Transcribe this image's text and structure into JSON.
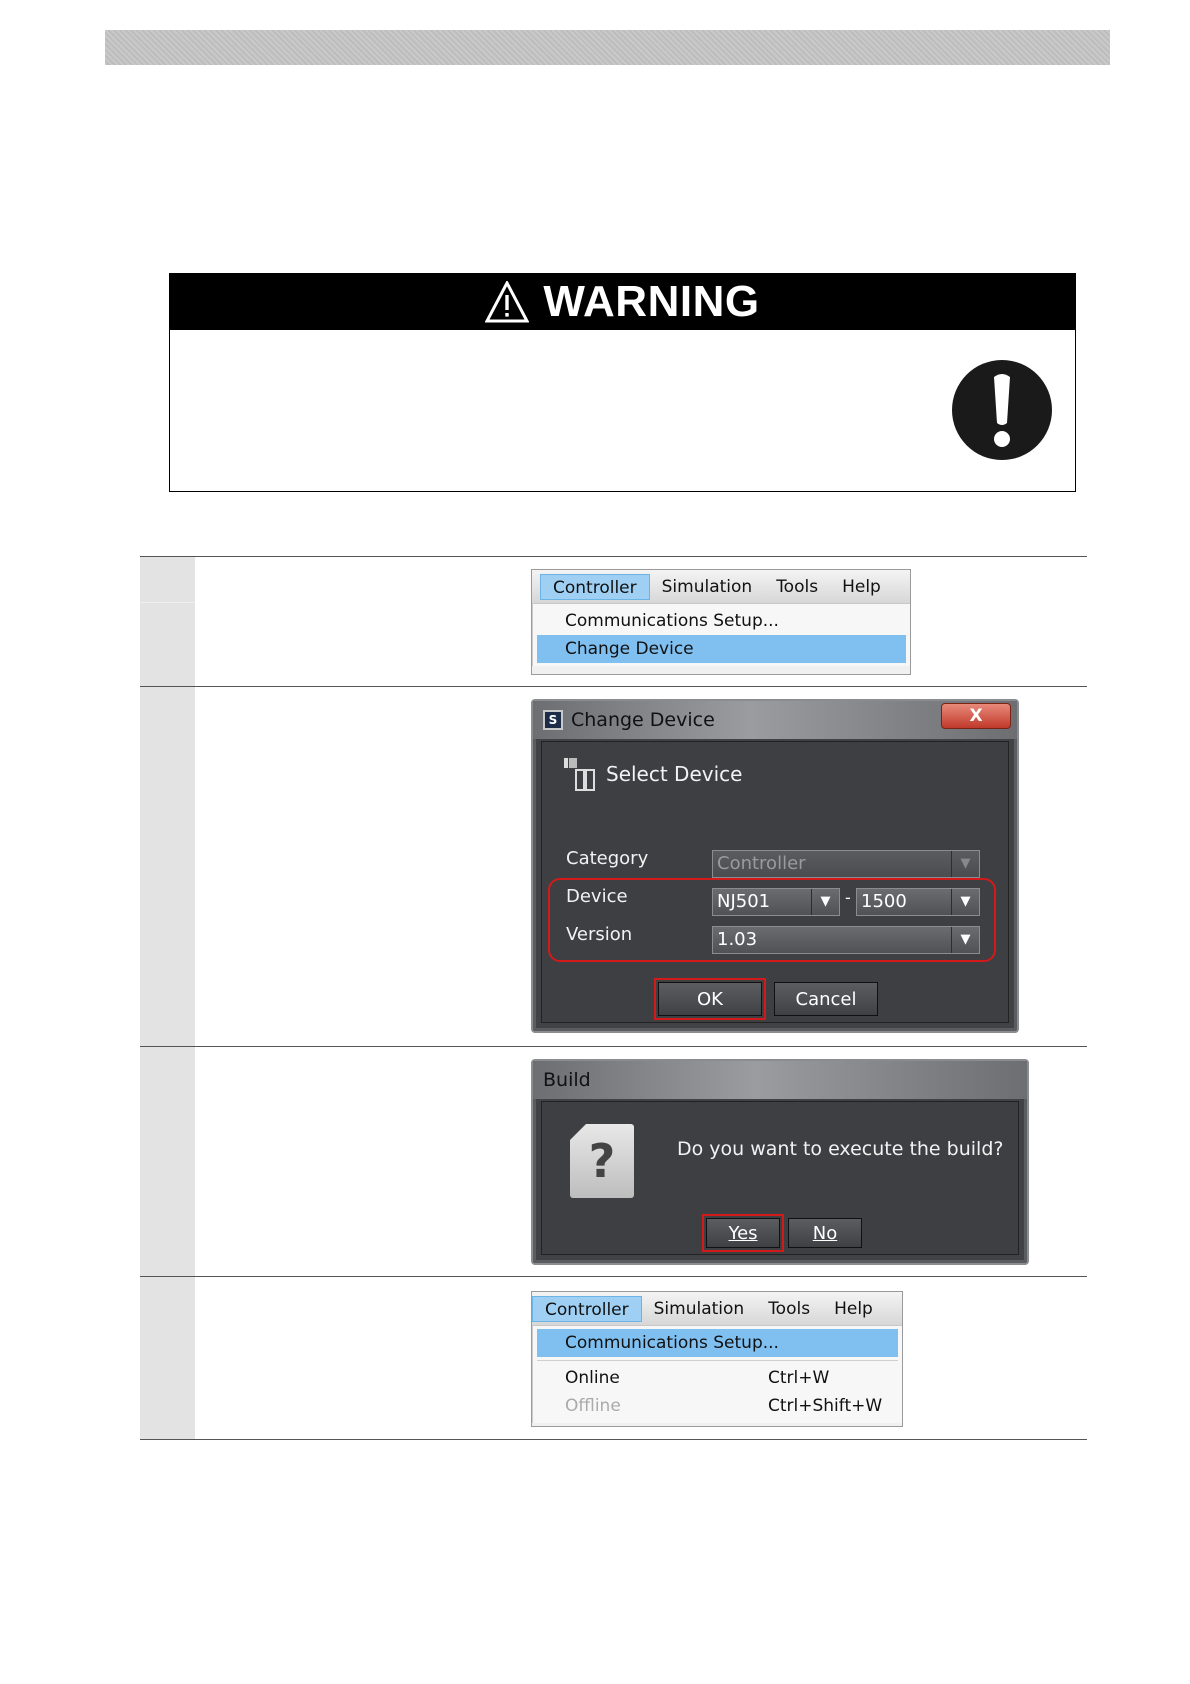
{
  "warning": {
    "title": "WARNING"
  },
  "step1": {
    "menubar": [
      "Controller",
      "Simulation",
      "Tools",
      "Help"
    ],
    "items": [
      "Communications Setup...",
      "Change Device"
    ]
  },
  "step2": {
    "dialog_title": "Change Device",
    "close": "X",
    "section": "Select Device",
    "category_label": "Category",
    "category_value": "Controller",
    "device_label": "Device",
    "device_value": "NJ501",
    "device_separator": "-",
    "device_model": "1500",
    "version_label": "Version",
    "version_value": "1.03",
    "ok": "OK",
    "cancel": "Cancel"
  },
  "step3": {
    "dialog_title": "Build",
    "question_icon": "?",
    "message": "Do you want to execute the build?",
    "yes": "Yes",
    "no": "No"
  },
  "step4": {
    "menubar": [
      "Controller",
      "Simulation",
      "Tools",
      "Help"
    ],
    "items": [
      {
        "label": "Communications Setup...",
        "shortcut": ""
      },
      {
        "label": "Online",
        "shortcut": "Ctrl+W"
      },
      {
        "label": "Offline",
        "shortcut": "Ctrl+Shift+W"
      }
    ]
  }
}
